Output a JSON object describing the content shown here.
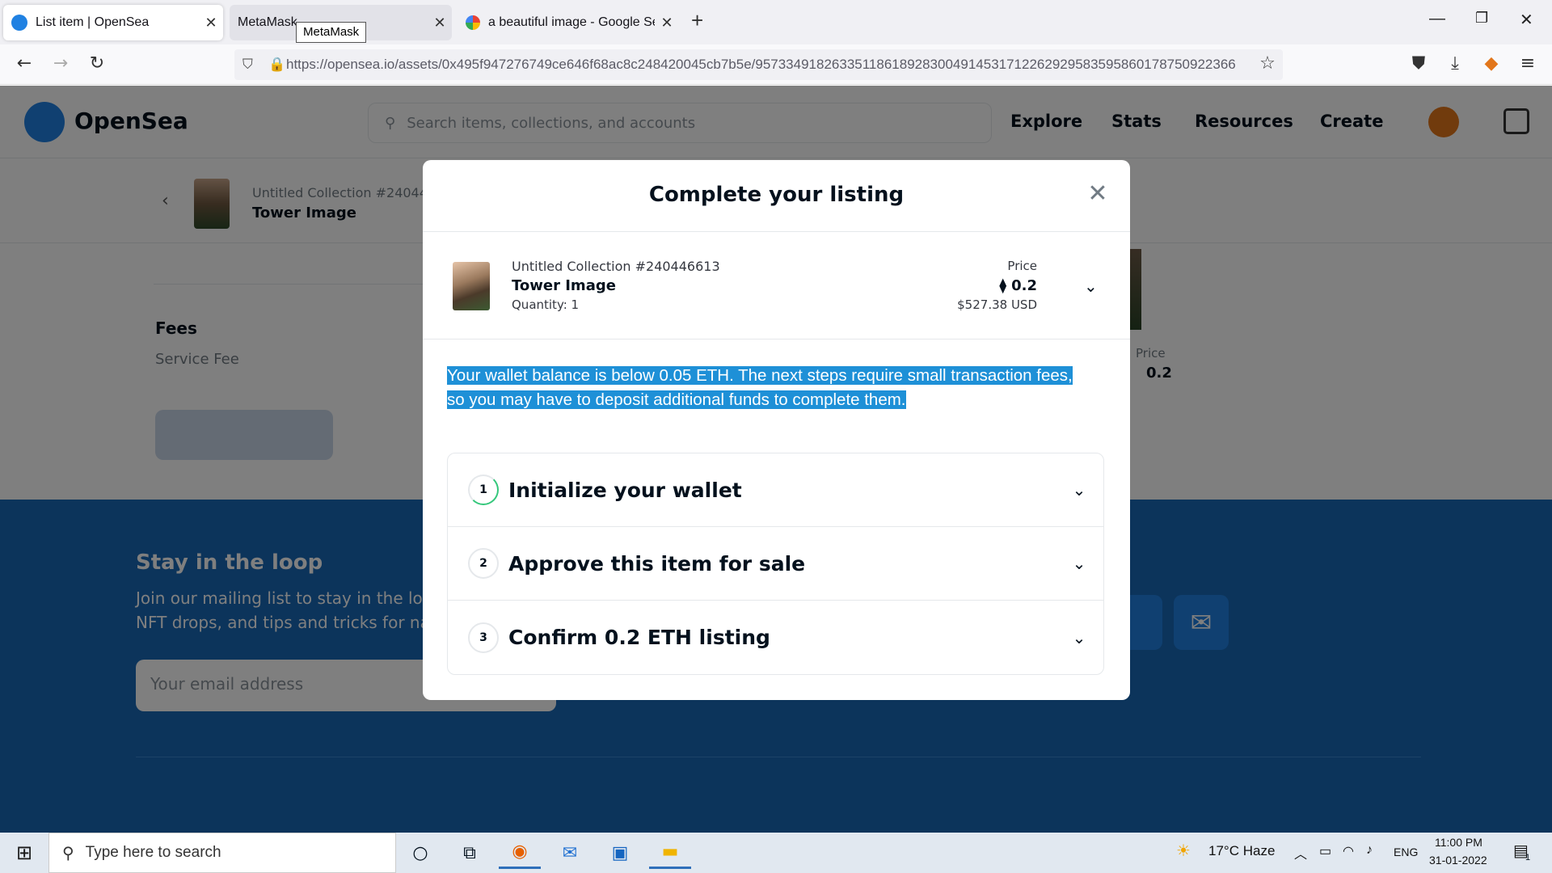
{
  "browser": {
    "tabs": [
      {
        "title": "List item | OpenSea",
        "active": true
      },
      {
        "title": "MetaMask",
        "active": false
      },
      {
        "title": "a beautiful image - Google Sea",
        "active": false
      }
    ],
    "tooltip": "MetaMask",
    "url": "https://opensea.io/assets/0x495f947276749ce646f68ac8c248420045cb7b5e/957334918263351186189283004914531712262929583595860178750922366"
  },
  "opensea": {
    "brand": "OpenSea",
    "search_placeholder": "Search items, collections, and accounts",
    "nav": [
      "Explore",
      "Stats",
      "Resources",
      "Create"
    ],
    "subheader": {
      "collection": "Untitled Collection #24044",
      "item": "Tower Image"
    },
    "fees_title": "Fees",
    "service_fee": "Service Fee",
    "bg_price_label": "Price",
    "bg_price_value": "0.2",
    "footer": {
      "title": "Stay in the loop",
      "text_line1": "Join our mailing list to stay in the loo",
      "text_line2": "NFT drops, and tips and tricks for na",
      "email_placeholder": "Your email address"
    }
  },
  "modal": {
    "title": "Complete your listing",
    "item": {
      "collection": "Untitled Collection #240446613",
      "name": "Tower Image",
      "quantity": "Quantity: 1",
      "price_label": "Price",
      "price": "0.2",
      "price_usd": "$527.38 USD"
    },
    "warning": "Your wallet balance is below 0.05 ETH. The next steps require small transaction fees, so you may have to deposit additional funds to complete them.",
    "steps": [
      {
        "num": "1",
        "title": "Initialize your wallet"
      },
      {
        "num": "2",
        "title": "Approve this item for sale"
      },
      {
        "num": "3",
        "title": "Confirm 0.2 ETH listing"
      }
    ]
  },
  "taskbar": {
    "search_placeholder": "Type here to search",
    "weather": "17°C  Haze",
    "language": "ENG",
    "time": "11:00 PM",
    "date": "31-01-2022",
    "notifications": "1"
  },
  "colors": {
    "accent": "#2081e2",
    "footer": "#1868b7",
    "highlight": "#1e90d7",
    "progress": "#34c77b"
  }
}
